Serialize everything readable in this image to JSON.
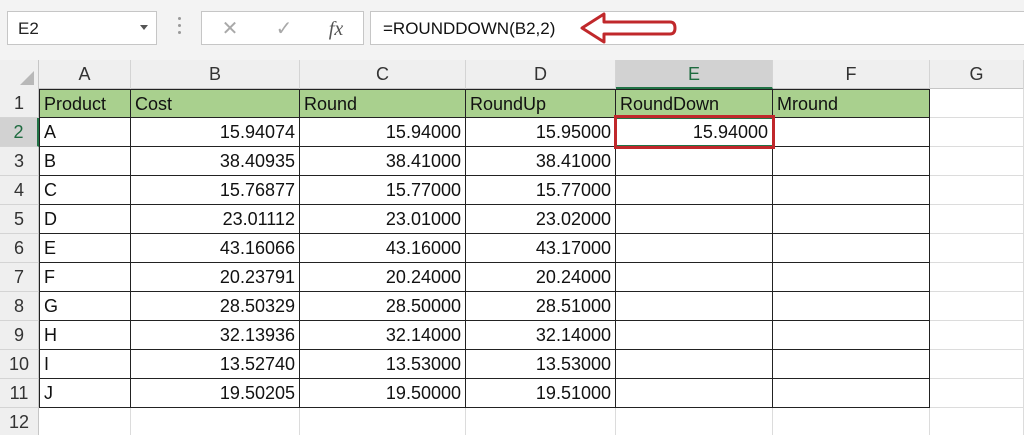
{
  "name_box": {
    "value": "E2"
  },
  "formula_bar": {
    "formula": "=ROUNDDOWN(B2,2)",
    "cancel_symbol": "✕",
    "enter_symbol": "✓",
    "fx_symbol": "fx"
  },
  "columns": [
    "A",
    "B",
    "C",
    "D",
    "E",
    "F",
    "G"
  ],
  "selected_column": "E",
  "rows": [
    "1",
    "2",
    "3",
    "4",
    "5",
    "6",
    "7",
    "8",
    "9",
    "10",
    "11",
    "12"
  ],
  "selected_row": "2",
  "table": {
    "headers": [
      "Product",
      "Cost",
      "Round",
      "RoundUp",
      "RoundDown",
      "Mround"
    ],
    "data": [
      [
        "A",
        "15.94074",
        "15.94000",
        "15.95000",
        "15.94000",
        ""
      ],
      [
        "B",
        "38.40935",
        "38.41000",
        "38.41000",
        "",
        ""
      ],
      [
        "C",
        "15.76877",
        "15.77000",
        "15.77000",
        "",
        ""
      ],
      [
        "D",
        "23.01112",
        "23.01000",
        "23.02000",
        "",
        ""
      ],
      [
        "E",
        "43.16066",
        "43.16000",
        "43.17000",
        "",
        ""
      ],
      [
        "F",
        "20.23791",
        "20.24000",
        "20.24000",
        "",
        ""
      ],
      [
        "G",
        "28.50329",
        "28.50000",
        "28.51000",
        "",
        ""
      ],
      [
        "H",
        "32.13936",
        "32.14000",
        "32.14000",
        "",
        ""
      ],
      [
        "I",
        "13.52740",
        "13.53000",
        "13.53000",
        "",
        ""
      ],
      [
        "J",
        "19.50205",
        "19.50000",
        "19.51000",
        "",
        ""
      ]
    ]
  },
  "colors": {
    "header_fill": "#a9d08e",
    "selection_green": "#217346",
    "annotation_red": "#c0282b"
  }
}
